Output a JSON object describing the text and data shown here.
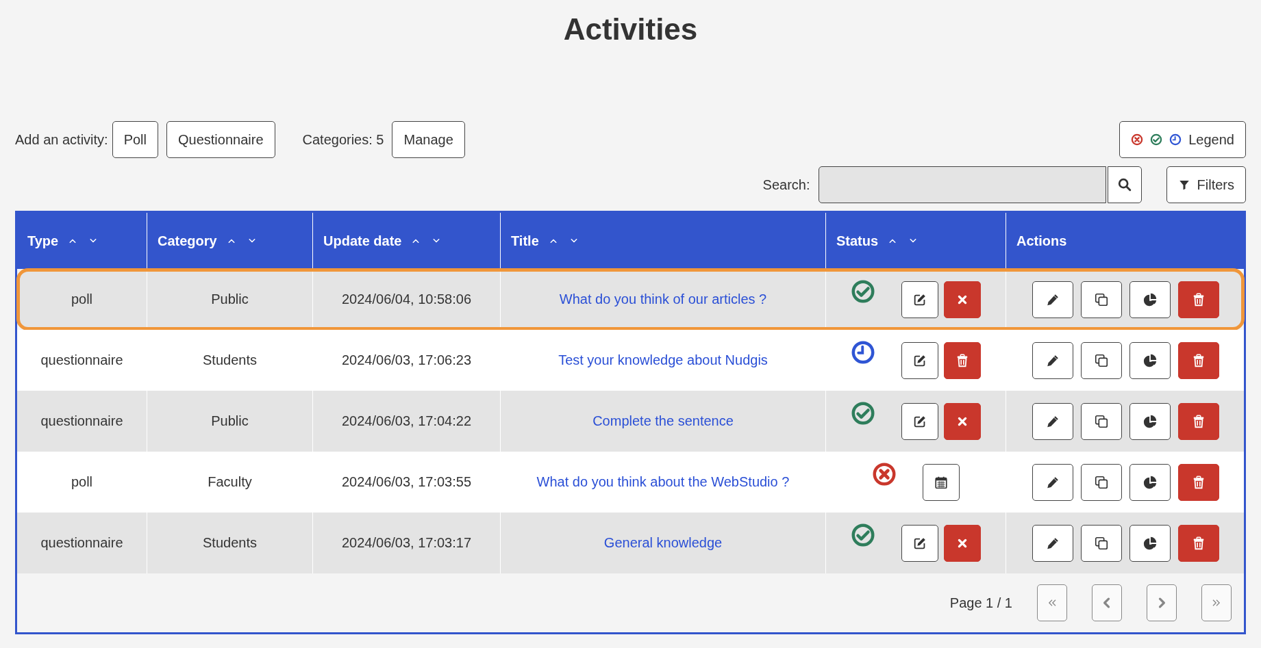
{
  "page": {
    "title": "Activities"
  },
  "toolbar": {
    "add_label": "Add an activity:",
    "add_buttons": [
      "Poll",
      "Questionnaire"
    ],
    "categories_label": "Categories: 5",
    "manage_button": "Manage",
    "legend_button": "Legend"
  },
  "search": {
    "label": "Search:"
  },
  "filters_button": "Filters",
  "table": {
    "columns": [
      {
        "label": "Type",
        "sortable": true
      },
      {
        "label": "Category",
        "sortable": true
      },
      {
        "label": "Update date",
        "sortable": true
      },
      {
        "label": "Title",
        "sortable": true
      },
      {
        "label": "Status",
        "sortable": true
      },
      {
        "label": "Actions",
        "sortable": false
      }
    ],
    "rows": [
      {
        "type": "poll",
        "category": "Public",
        "update_date": "2024/06/04, 10:58:06",
        "title": "What do you think of our articles ?",
        "status": {
          "kind": "published"
        },
        "status_actions": [
          {
            "kind": "edit"
          },
          {
            "kind": "close"
          }
        ],
        "highlighted": true
      },
      {
        "type": "questionnaire",
        "category": "Students",
        "update_date": "2024/06/03, 17:06:23",
        "title": "Test your knowledge about Nudgis",
        "status": {
          "kind": "pending"
        },
        "status_actions": [
          {
            "kind": "edit"
          },
          {
            "kind": "delete"
          }
        ],
        "highlighted": false
      },
      {
        "type": "questionnaire",
        "category": "Public",
        "update_date": "2024/06/03, 17:04:22",
        "title": "Complete the sentence",
        "status": {
          "kind": "published"
        },
        "status_actions": [
          {
            "kind": "edit"
          },
          {
            "kind": "close"
          }
        ],
        "highlighted": false
      },
      {
        "type": "poll",
        "category": "Faculty",
        "update_date": "2024/06/03, 17:03:55",
        "title": "What do you think about the WebStudio ?",
        "status": {
          "kind": "closed"
        },
        "status_actions": [
          {
            "kind": "schedule"
          }
        ],
        "highlighted": false
      },
      {
        "type": "questionnaire",
        "category": "Students",
        "update_date": "2024/06/03, 17:03:17",
        "title": "General knowledge",
        "status": {
          "kind": "published"
        },
        "status_actions": [
          {
            "kind": "edit"
          },
          {
            "kind": "close"
          }
        ],
        "highlighted": false
      }
    ]
  },
  "pagination": {
    "label": "Page 1 / 1"
  }
}
